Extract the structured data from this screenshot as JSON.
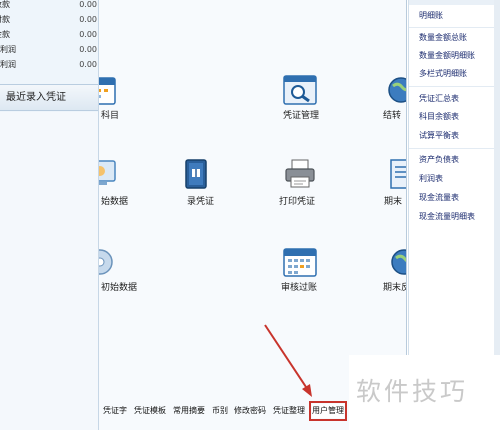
{
  "left_panel": {
    "stats": [
      {
        "label": "应收款",
        "value": "0.00"
      },
      {
        "label": "应付款",
        "value": "0.00"
      },
      {
        "label": "现金款",
        "value": "0.00"
      },
      {
        "label": "本期利润",
        "value": "0.00"
      },
      {
        "label": "累计利润",
        "value": "0.00"
      }
    ],
    "recent_vouchers_tab": "最近录入凭证"
  },
  "functions": [
    {
      "label": "科目",
      "icon": "calendar-icon"
    },
    {
      "label": "凭证管理",
      "icon": "search-voucher-icon"
    },
    {
      "label": "结转",
      "icon": "globe-icon"
    },
    {
      "label": "始数据",
      "icon": "monitor-icon"
    },
    {
      "label": "录凭证",
      "icon": "voucher-book-icon"
    },
    {
      "label": "打印凭证",
      "icon": "printer-icon"
    },
    {
      "label": "期末",
      "icon": "document-icon"
    },
    {
      "label": "初始数据",
      "icon": "disk-icon"
    },
    {
      "label": "审核过账",
      "icon": "calendar-check-icon"
    },
    {
      "label": "期末反",
      "icon": "globe-icon"
    }
  ],
  "bottom_tabs": [
    "凭证字",
    "凭证模板",
    "常用摘要",
    "币别",
    "修改密码",
    "凭证整理",
    "用户管理"
  ],
  "right_panel": {
    "groups": [
      [
        "明细账"
      ],
      [
        "数量金额总账",
        "数量金额明细账",
        "多栏式明细账"
      ],
      [
        "凭证汇总表",
        "科目余额表",
        "试算平衡表"
      ],
      [
        "资产负债表",
        "利润表",
        "现金流量表",
        "现金流量明细表"
      ]
    ]
  },
  "watermark": "软件技巧",
  "colors": {
    "highlight": "#c8342c",
    "link": "#1a2a6e",
    "panel_bg": "#f7fafd"
  }
}
